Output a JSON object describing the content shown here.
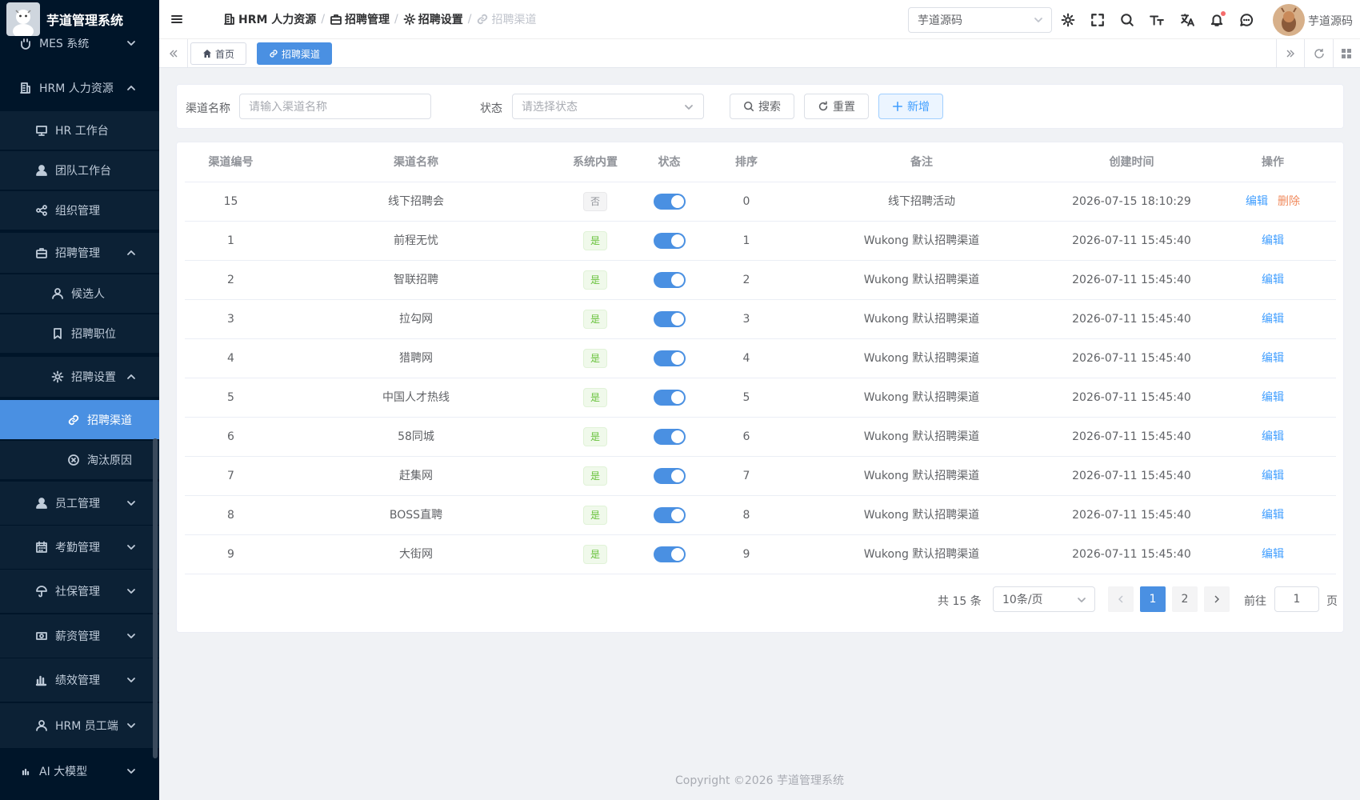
{
  "app": {
    "title": "芋道管理系统"
  },
  "sidebar": {
    "items": [
      {
        "label": "MES 系统"
      },
      {
        "label": "HRM 人力资源"
      },
      {
        "label": "HR 工作台"
      },
      {
        "label": "团队工作台"
      },
      {
        "label": "组织管理"
      },
      {
        "label": "招聘管理"
      },
      {
        "label": "候选人"
      },
      {
        "label": "招聘职位"
      },
      {
        "label": "招聘设置"
      },
      {
        "label": "招聘渠道"
      },
      {
        "label": "淘汰原因"
      },
      {
        "label": "员工管理"
      },
      {
        "label": "考勤管理"
      },
      {
        "label": "社保管理"
      },
      {
        "label": "薪资管理"
      },
      {
        "label": "绩效管理"
      },
      {
        "label": "HRM 员工端"
      },
      {
        "label": "AI 大模型"
      }
    ]
  },
  "header": {
    "breadcrumb": [
      "HRM 人力资源",
      "招聘管理",
      "招聘设置",
      "招聘渠道"
    ],
    "tenant": "芋道源码",
    "username": "芋道源码"
  },
  "tags": [
    {
      "label": "首页"
    },
    {
      "label": "招聘渠道"
    }
  ],
  "search": {
    "name_label": "渠道名称",
    "name_placeholder": "请输入渠道名称",
    "status_label": "状态",
    "status_placeholder": "请选择状态",
    "search_btn": "搜索",
    "reset_btn": "重置",
    "add_btn": "新增"
  },
  "table": {
    "columns": [
      "渠道编号",
      "渠道名称",
      "系统内置",
      "状态",
      "排序",
      "备注",
      "创建时间",
      "操作"
    ],
    "edit_label": "编辑",
    "delete_label": "删除",
    "rows": [
      {
        "id": "15",
        "name": "线下招聘会",
        "builtin": "否",
        "sort": "0",
        "remark": "线下招聘活动",
        "created": "2026-07-15 18:10:29"
      },
      {
        "id": "1",
        "name": "前程无忧",
        "builtin": "是",
        "sort": "1",
        "remark": "Wukong 默认招聘渠道",
        "created": "2026-07-11 15:45:40"
      },
      {
        "id": "2",
        "name": "智联招聘",
        "builtin": "是",
        "sort": "2",
        "remark": "Wukong 默认招聘渠道",
        "created": "2026-07-11 15:45:40"
      },
      {
        "id": "3",
        "name": "拉勾网",
        "builtin": "是",
        "sort": "3",
        "remark": "Wukong 默认招聘渠道",
        "created": "2026-07-11 15:45:40"
      },
      {
        "id": "4",
        "name": "猎聘网",
        "builtin": "是",
        "sort": "4",
        "remark": "Wukong 默认招聘渠道",
        "created": "2026-07-11 15:45:40"
      },
      {
        "id": "5",
        "name": "中国人才热线",
        "builtin": "是",
        "sort": "5",
        "remark": "Wukong 默认招聘渠道",
        "created": "2026-07-11 15:45:40"
      },
      {
        "id": "6",
        "name": "58同城",
        "builtin": "是",
        "sort": "6",
        "remark": "Wukong 默认招聘渠道",
        "created": "2026-07-11 15:45:40"
      },
      {
        "id": "7",
        "name": "赶集网",
        "builtin": "是",
        "sort": "7",
        "remark": "Wukong 默认招聘渠道",
        "created": "2026-07-11 15:45:40"
      },
      {
        "id": "8",
        "name": "BOSS直聘",
        "builtin": "是",
        "sort": "8",
        "remark": "Wukong 默认招聘渠道",
        "created": "2026-07-11 15:45:40"
      },
      {
        "id": "9",
        "name": "大街网",
        "builtin": "是",
        "sort": "9",
        "remark": "Wukong 默认招聘渠道",
        "created": "2026-07-11 15:45:40"
      }
    ]
  },
  "pagination": {
    "total": "共 15 条",
    "page_size": "10条/页",
    "pages": [
      "1",
      "2"
    ],
    "goto_label": "前往",
    "goto_value": "1",
    "page_suffix": "页"
  },
  "footer": {
    "copyright": "Copyright ©2026 芋道管理系统"
  },
  "colors": {
    "sidebar_bg": "#001529",
    "active": "#4a90e2",
    "primary": "#409eff",
    "danger": "#f08a5d"
  }
}
